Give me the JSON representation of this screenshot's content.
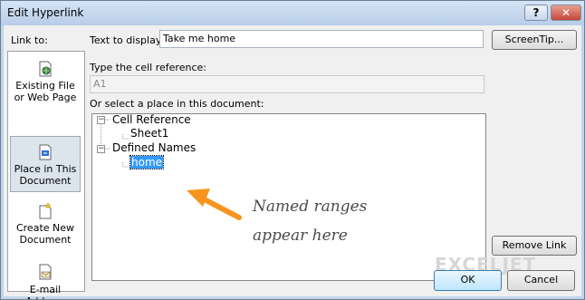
{
  "window": {
    "title": "Edit Hyperlink",
    "help_glyph": "?",
    "close_glyph": "✕"
  },
  "sidebar": {
    "label": "Link to:",
    "items": [
      {
        "label": "Existing File or Web Page",
        "icon": "globe-icon",
        "selected": false
      },
      {
        "label": "Place in This Document",
        "icon": "document-link-icon",
        "selected": true
      },
      {
        "label": "Create New Document",
        "icon": "new-document-icon",
        "selected": false
      },
      {
        "label": "E-mail Address",
        "icon": "email-icon",
        "selected": false
      }
    ]
  },
  "text_to_display": {
    "label": "Text to display:",
    "value": "Take me home"
  },
  "cell_reference": {
    "label": "Type the cell reference:",
    "value": "A1"
  },
  "place_list": {
    "label": "Or select a place in this document:",
    "groups": [
      {
        "label": "Cell Reference",
        "expander": "−",
        "children": [
          "Sheet1"
        ]
      },
      {
        "label": "Defined Names",
        "expander": "−",
        "children": [
          "home"
        ]
      }
    ],
    "selected_item": "home"
  },
  "buttons": {
    "screentip": "ScreenTip...",
    "remove_link": "Remove Link",
    "ok": "OK",
    "cancel": "Cancel"
  },
  "annotation": {
    "line1": "Named ranges",
    "line2": "appear here",
    "arrow_color": "#f7941d"
  },
  "watermark": "EXCELJET"
}
